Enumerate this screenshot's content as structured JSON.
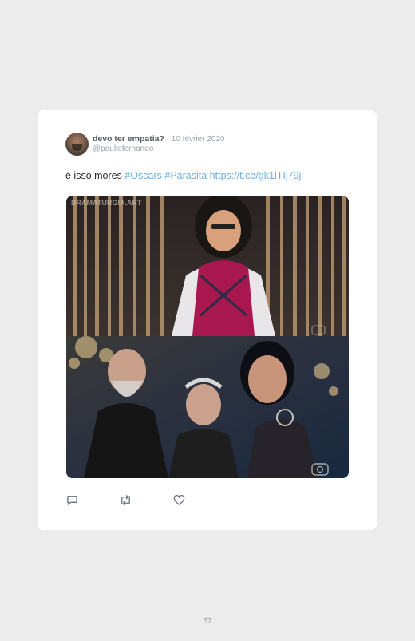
{
  "tweet": {
    "display_name": "devo ter empatia?",
    "separator": " · ",
    "date": "10 février 2020",
    "handle": "@paullofernando",
    "text_plain": "é isso mores ",
    "hashtag_1": "#Oscars",
    "hashtag_2": "#Parasita",
    "link": "https://t.co/gk1lTIj79j",
    "image_watermark": "DRAMATURGIA.ART"
  },
  "actions": {
    "reply_icon": "reply-icon",
    "retweet_icon": "retweet-icon",
    "like_icon": "heart-icon"
  },
  "page": {
    "number": "67"
  }
}
